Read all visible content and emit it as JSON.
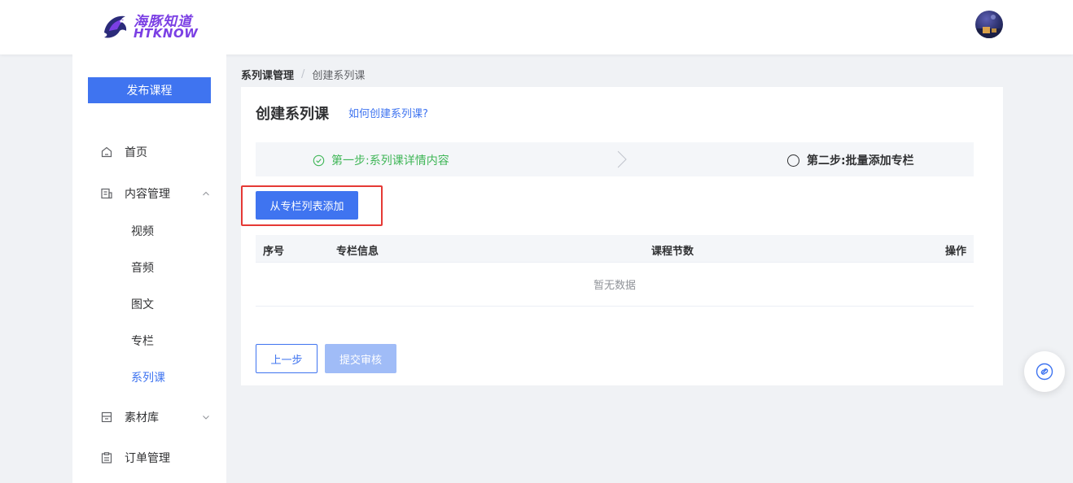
{
  "header": {
    "logo_cn": "海豚知道",
    "logo_en": "HTKNOW"
  },
  "sidebar": {
    "publish_label": "发布课程",
    "items": [
      {
        "label": "首页",
        "icon": "home-icon"
      },
      {
        "label": "内容管理",
        "icon": "content-icon",
        "expanded": true
      },
      {
        "label": "素材库",
        "icon": "folder-icon",
        "expanded": false
      },
      {
        "label": "订单管理",
        "icon": "clipboard-icon"
      }
    ],
    "sub_items": [
      {
        "label": "视频"
      },
      {
        "label": "音频"
      },
      {
        "label": "图文"
      },
      {
        "label": "专栏"
      },
      {
        "label": "系列课",
        "active": true
      }
    ]
  },
  "breadcrumb": {
    "first": "系列课管理",
    "separator": "/",
    "current": "创建系列课"
  },
  "main": {
    "title": "创建系列课",
    "help_link": "如何创建系列课?",
    "steps": {
      "step1": "第一步:系列课详情内容",
      "step2": "第二步:批量添加专栏"
    },
    "add_button": "从专栏列表添加",
    "table": {
      "columns": [
        "序号",
        "专栏信息",
        "课程节数",
        "操作"
      ],
      "empty_text": "暂无数据"
    },
    "prev_button": "上一步",
    "submit_button": "提交审核"
  },
  "colors": {
    "primary": "#3f74f0",
    "success": "#3fb657",
    "highlight": "#e53935",
    "disabled": "#a0bcf7"
  }
}
